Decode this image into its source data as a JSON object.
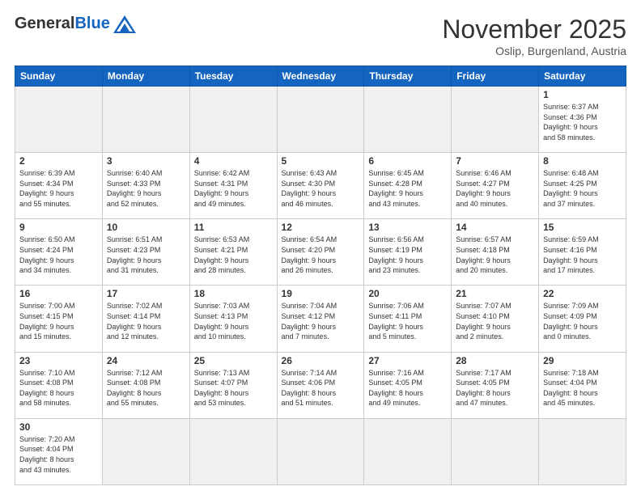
{
  "logo": {
    "general": "General",
    "blue": "Blue"
  },
  "title": "November 2025",
  "location": "Oslip, Burgenland, Austria",
  "days_of_week": [
    "Sunday",
    "Monday",
    "Tuesday",
    "Wednesday",
    "Thursday",
    "Friday",
    "Saturday"
  ],
  "weeks": [
    [
      {
        "day": "",
        "info": "",
        "empty": true
      },
      {
        "day": "",
        "info": "",
        "empty": true
      },
      {
        "day": "",
        "info": "",
        "empty": true
      },
      {
        "day": "",
        "info": "",
        "empty": true
      },
      {
        "day": "",
        "info": "",
        "empty": true
      },
      {
        "day": "",
        "info": "",
        "empty": true
      },
      {
        "day": "1",
        "info": "Sunrise: 6:37 AM\nSunset: 4:36 PM\nDaylight: 9 hours\nand 58 minutes."
      }
    ],
    [
      {
        "day": "2",
        "info": "Sunrise: 6:39 AM\nSunset: 4:34 PM\nDaylight: 9 hours\nand 55 minutes."
      },
      {
        "day": "3",
        "info": "Sunrise: 6:40 AM\nSunset: 4:33 PM\nDaylight: 9 hours\nand 52 minutes."
      },
      {
        "day": "4",
        "info": "Sunrise: 6:42 AM\nSunset: 4:31 PM\nDaylight: 9 hours\nand 49 minutes."
      },
      {
        "day": "5",
        "info": "Sunrise: 6:43 AM\nSunset: 4:30 PM\nDaylight: 9 hours\nand 46 minutes."
      },
      {
        "day": "6",
        "info": "Sunrise: 6:45 AM\nSunset: 4:28 PM\nDaylight: 9 hours\nand 43 minutes."
      },
      {
        "day": "7",
        "info": "Sunrise: 6:46 AM\nSunset: 4:27 PM\nDaylight: 9 hours\nand 40 minutes."
      },
      {
        "day": "8",
        "info": "Sunrise: 6:48 AM\nSunset: 4:25 PM\nDaylight: 9 hours\nand 37 minutes."
      }
    ],
    [
      {
        "day": "9",
        "info": "Sunrise: 6:50 AM\nSunset: 4:24 PM\nDaylight: 9 hours\nand 34 minutes."
      },
      {
        "day": "10",
        "info": "Sunrise: 6:51 AM\nSunset: 4:23 PM\nDaylight: 9 hours\nand 31 minutes."
      },
      {
        "day": "11",
        "info": "Sunrise: 6:53 AM\nSunset: 4:21 PM\nDaylight: 9 hours\nand 28 minutes."
      },
      {
        "day": "12",
        "info": "Sunrise: 6:54 AM\nSunset: 4:20 PM\nDaylight: 9 hours\nand 26 minutes."
      },
      {
        "day": "13",
        "info": "Sunrise: 6:56 AM\nSunset: 4:19 PM\nDaylight: 9 hours\nand 23 minutes."
      },
      {
        "day": "14",
        "info": "Sunrise: 6:57 AM\nSunset: 4:18 PM\nDaylight: 9 hours\nand 20 minutes."
      },
      {
        "day": "15",
        "info": "Sunrise: 6:59 AM\nSunset: 4:16 PM\nDaylight: 9 hours\nand 17 minutes."
      }
    ],
    [
      {
        "day": "16",
        "info": "Sunrise: 7:00 AM\nSunset: 4:15 PM\nDaylight: 9 hours\nand 15 minutes."
      },
      {
        "day": "17",
        "info": "Sunrise: 7:02 AM\nSunset: 4:14 PM\nDaylight: 9 hours\nand 12 minutes."
      },
      {
        "day": "18",
        "info": "Sunrise: 7:03 AM\nSunset: 4:13 PM\nDaylight: 9 hours\nand 10 minutes."
      },
      {
        "day": "19",
        "info": "Sunrise: 7:04 AM\nSunset: 4:12 PM\nDaylight: 9 hours\nand 7 minutes."
      },
      {
        "day": "20",
        "info": "Sunrise: 7:06 AM\nSunset: 4:11 PM\nDaylight: 9 hours\nand 5 minutes."
      },
      {
        "day": "21",
        "info": "Sunrise: 7:07 AM\nSunset: 4:10 PM\nDaylight: 9 hours\nand 2 minutes."
      },
      {
        "day": "22",
        "info": "Sunrise: 7:09 AM\nSunset: 4:09 PM\nDaylight: 9 hours\nand 0 minutes."
      }
    ],
    [
      {
        "day": "23",
        "info": "Sunrise: 7:10 AM\nSunset: 4:08 PM\nDaylight: 8 hours\nand 58 minutes."
      },
      {
        "day": "24",
        "info": "Sunrise: 7:12 AM\nSunset: 4:08 PM\nDaylight: 8 hours\nand 55 minutes."
      },
      {
        "day": "25",
        "info": "Sunrise: 7:13 AM\nSunset: 4:07 PM\nDaylight: 8 hours\nand 53 minutes."
      },
      {
        "day": "26",
        "info": "Sunrise: 7:14 AM\nSunset: 4:06 PM\nDaylight: 8 hours\nand 51 minutes."
      },
      {
        "day": "27",
        "info": "Sunrise: 7:16 AM\nSunset: 4:05 PM\nDaylight: 8 hours\nand 49 minutes."
      },
      {
        "day": "28",
        "info": "Sunrise: 7:17 AM\nSunset: 4:05 PM\nDaylight: 8 hours\nand 47 minutes."
      },
      {
        "day": "29",
        "info": "Sunrise: 7:18 AM\nSunset: 4:04 PM\nDaylight: 8 hours\nand 45 minutes."
      }
    ],
    [
      {
        "day": "30",
        "info": "Sunrise: 7:20 AM\nSunset: 4:04 PM\nDaylight: 8 hours\nand 43 minutes."
      },
      {
        "day": "",
        "info": "",
        "empty": true
      },
      {
        "day": "",
        "info": "",
        "empty": true
      },
      {
        "day": "",
        "info": "",
        "empty": true
      },
      {
        "day": "",
        "info": "",
        "empty": true
      },
      {
        "day": "",
        "info": "",
        "empty": true
      },
      {
        "day": "",
        "info": "",
        "empty": true
      }
    ]
  ]
}
